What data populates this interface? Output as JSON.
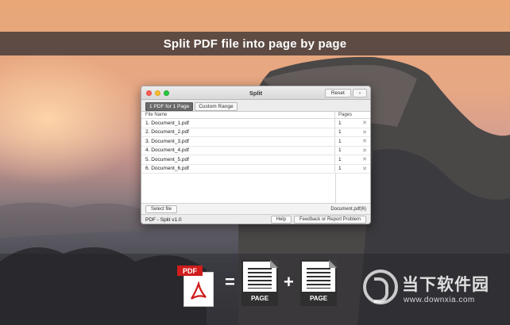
{
  "banner": {
    "title": "Split PDF file into page by page"
  },
  "window": {
    "title": "Split",
    "reset_label": "Reset",
    "chevron_label": "›",
    "tabs": [
      {
        "label": "1 PDF for 1 Page"
      },
      {
        "label": "Custom Range"
      }
    ],
    "table": {
      "columns": {
        "file_name": "File Name",
        "pages": "Pages"
      },
      "rows": [
        {
          "name": "1. Document_1.pdf",
          "pages": "1"
        },
        {
          "name": "2. Document_2.pdf",
          "pages": "1"
        },
        {
          "name": "3. Document_3.pdf",
          "pages": "1"
        },
        {
          "name": "4. Document_4.pdf",
          "pages": "1"
        },
        {
          "name": "5. Document_5.pdf",
          "pages": "1"
        },
        {
          "name": "6. Document_6.pdf",
          "pages": "1"
        }
      ]
    },
    "select_file_label": "Select file",
    "selected_file": "Document.pdf(6)",
    "footer": {
      "app_title": "PDF - Split v1.0",
      "help_label": "Help",
      "feedback_label": "Feedback or Report Problem"
    }
  },
  "illustration": {
    "pdf_label": "PDF",
    "equals": "=",
    "plus": "+",
    "page_label_1": "PAGE",
    "page_label_2": "PAGE"
  },
  "watermark": {
    "text": "当下软件园",
    "url": "www.downxia.com"
  }
}
